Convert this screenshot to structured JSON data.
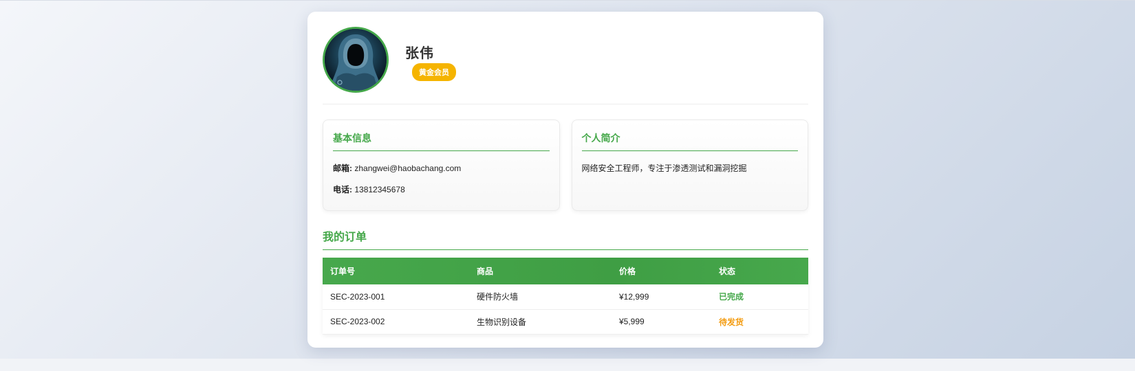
{
  "profile": {
    "name": "张伟",
    "badge": "黄金会员"
  },
  "basic_info": {
    "title": "基本信息",
    "email_label": "邮箱:",
    "email": "zhangwei@haobachang.com",
    "phone_label": "电话:",
    "phone": "13812345678"
  },
  "bio": {
    "title": "个人简介",
    "text": "网络安全工程师，专注于渗透测试和漏洞挖掘"
  },
  "orders": {
    "title": "我的订单",
    "columns": [
      "订单号",
      "商品",
      "价格",
      "状态"
    ],
    "rows": [
      {
        "id": "SEC-2023-001",
        "product": "硬件防火墙",
        "price": "¥12,999",
        "status": "已完成"
      },
      {
        "id": "SEC-2023-002",
        "product": "生物识别设备",
        "price": "¥5,999",
        "status": "待发货"
      }
    ]
  },
  "colors": {
    "accent": "#45a84a",
    "badge": "#f5b400",
    "pending": "#f39c12"
  }
}
